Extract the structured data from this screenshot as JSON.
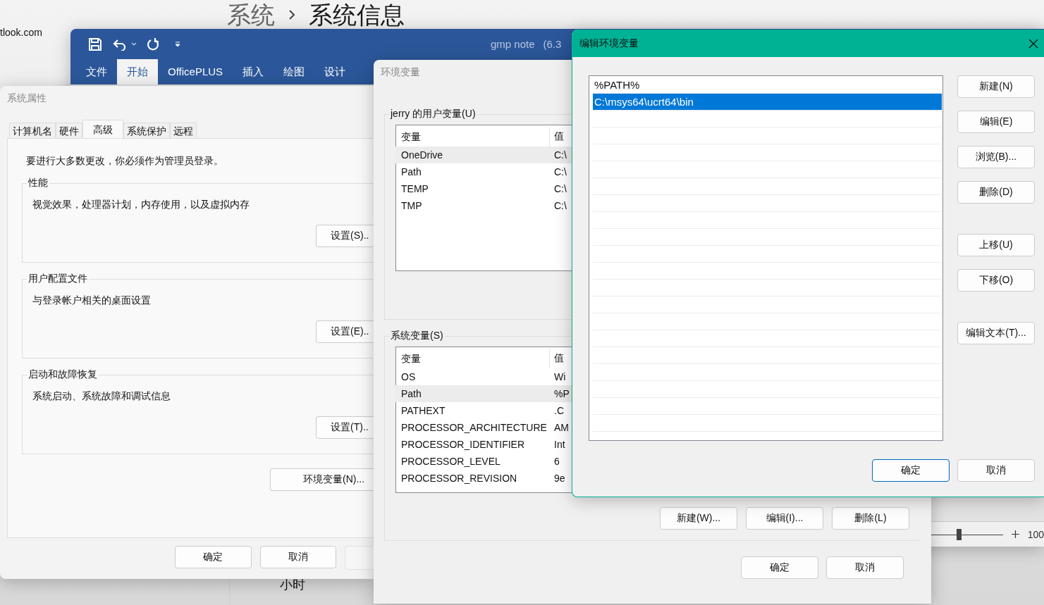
{
  "settings_page": {
    "breadcrumb": [
      {
        "label": "系统",
        "selected": false
      },
      {
        "label": "系统信息",
        "selected": true
      }
    ],
    "account_email": "tlook.com",
    "sidebar_text": "小时"
  },
  "word_window": {
    "title": "gmp note",
    "title_suffix": "(6.3",
    "tabs": [
      {
        "label": "文件",
        "selected": false
      },
      {
        "label": "开始",
        "selected": true
      },
      {
        "label": "OfficePLUS",
        "selected": false
      },
      {
        "label": "插入",
        "selected": false
      },
      {
        "label": "绘图",
        "selected": false
      },
      {
        "label": "设计",
        "selected": false
      }
    ],
    "zoom_slider": {
      "level": 0.4
    },
    "zoom_percent": "100"
  },
  "system_properties": {
    "title": "系统属性",
    "tabs": [
      {
        "label": "计算机名",
        "selected": false
      },
      {
        "label": "硬件",
        "selected": false
      },
      {
        "label": "高级",
        "selected": true
      },
      {
        "label": "系统保护",
        "selected": false
      },
      {
        "label": "远程",
        "selected": false
      }
    ],
    "notice": "要进行大多数更改，你必须作为管理员登录。",
    "groups": [
      {
        "title": "性能",
        "description": "视觉效果，处理器计划，内存使用，以及虚拟内存",
        "button": "设置(S).."
      },
      {
        "title": "用户配置文件",
        "description": "与登录帐户相关的桌面设置",
        "button": "设置(E).."
      },
      {
        "title": "启动和故障恢复",
        "description": "系统启动、系统故障和调试信息",
        "button": "设置(T).."
      }
    ],
    "env_button": "环境变量(N)...",
    "buttons": [
      "确定",
      "取消"
    ]
  },
  "environment_variables": {
    "title": "环境变量",
    "user_group": {
      "title": "jerry 的用户变量(U)",
      "columns": [
        "变量",
        "值"
      ],
      "rows": [
        {
          "name": "OneDrive",
          "value": "C:\\",
          "highlighted": true
        },
        {
          "name": "Path",
          "value": "C:\\",
          "highlighted": false
        },
        {
          "name": "TEMP",
          "value": "C:\\",
          "highlighted": false
        },
        {
          "name": "TMP",
          "value": "C:\\",
          "highlighted": false
        }
      ]
    },
    "system_group": {
      "title": "系统变量(S)",
      "columns": [
        "变量",
        "值"
      ],
      "rows": [
        {
          "name": "OS",
          "value": "Wi",
          "highlighted": false
        },
        {
          "name": "Path",
          "value": "%P",
          "highlighted": true
        },
        {
          "name": "PATHEXT",
          "value": ".C",
          "highlighted": false
        },
        {
          "name": "PROCESSOR_ARCHITECTURE",
          "value": "AM",
          "highlighted": false
        },
        {
          "name": "PROCESSOR_IDENTIFIER",
          "value": "Int",
          "highlighted": false
        },
        {
          "name": "PROCESSOR_LEVEL",
          "value": "6",
          "highlighted": false
        },
        {
          "name": "PROCESSOR_REVISION",
          "value": "9e",
          "highlighted": false
        }
      ],
      "buttons": [
        "新建(W)...",
        "编辑(I)...",
        "删除(L)"
      ]
    },
    "buttons": [
      "确定",
      "取消"
    ]
  },
  "edit_dialog": {
    "title": "编辑环境变量",
    "entries": [
      {
        "text": "%PATH%",
        "selected": false
      },
      {
        "text": "C:\\msys64\\ucrt64\\bin",
        "selected": true
      }
    ],
    "side_button_groups": [
      [
        "新建(N)",
        "编辑(E)",
        "浏览(B)...",
        "删除(D)"
      ],
      [
        "上移(U)",
        "下移(O)"
      ],
      [
        "编辑文本(T)..."
      ]
    ],
    "buttons": [
      {
        "label": "确定",
        "default": true
      },
      {
        "label": "取消",
        "default": false
      }
    ]
  }
}
